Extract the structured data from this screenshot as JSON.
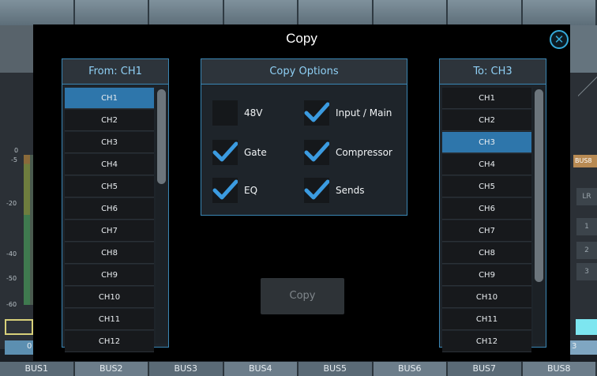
{
  "background": {
    "meter_scale": [
      "0",
      "-5",
      "-20",
      "-40",
      "-50",
      "-60"
    ],
    "zero_readout": "0",
    "three_readout": "3",
    "bus8_tag": "BUS8",
    "side_buttons": [
      "LR",
      "1",
      "2",
      "3"
    ],
    "bus_tabs": [
      "BUS1",
      "BUS2",
      "BUS3",
      "BUS4",
      "BUS5",
      "BUS6",
      "BUS7",
      "BUS8"
    ]
  },
  "modal": {
    "title": "Copy",
    "close_icon": "close-icon",
    "from_panel": {
      "header": "From: CH1",
      "selected": "CH1",
      "channels": [
        "CH1",
        "CH2",
        "CH3",
        "CH4",
        "CH5",
        "CH6",
        "CH7",
        "CH8",
        "CH9",
        "CH10",
        "CH11",
        "CH12"
      ]
    },
    "options_panel": {
      "header": "Copy Options",
      "options": [
        {
          "label": "48V",
          "checked": false
        },
        {
          "label": "Input / Main",
          "checked": true
        },
        {
          "label": "Gate",
          "checked": true
        },
        {
          "label": "Compressor",
          "checked": true
        },
        {
          "label": "EQ",
          "checked": true
        },
        {
          "label": "Sends",
          "checked": true
        }
      ]
    },
    "to_panel": {
      "header": "To: CH3",
      "selected": "CH3",
      "channels": [
        "CH1",
        "CH2",
        "CH3",
        "CH4",
        "CH5",
        "CH6",
        "CH7",
        "CH8",
        "CH9",
        "CH10",
        "CH11",
        "CH12"
      ]
    },
    "copy_button": "Copy"
  },
  "colors": {
    "accent": "#2e76ab",
    "header_text": "#8fd0f5",
    "check": "#3b9be0"
  }
}
